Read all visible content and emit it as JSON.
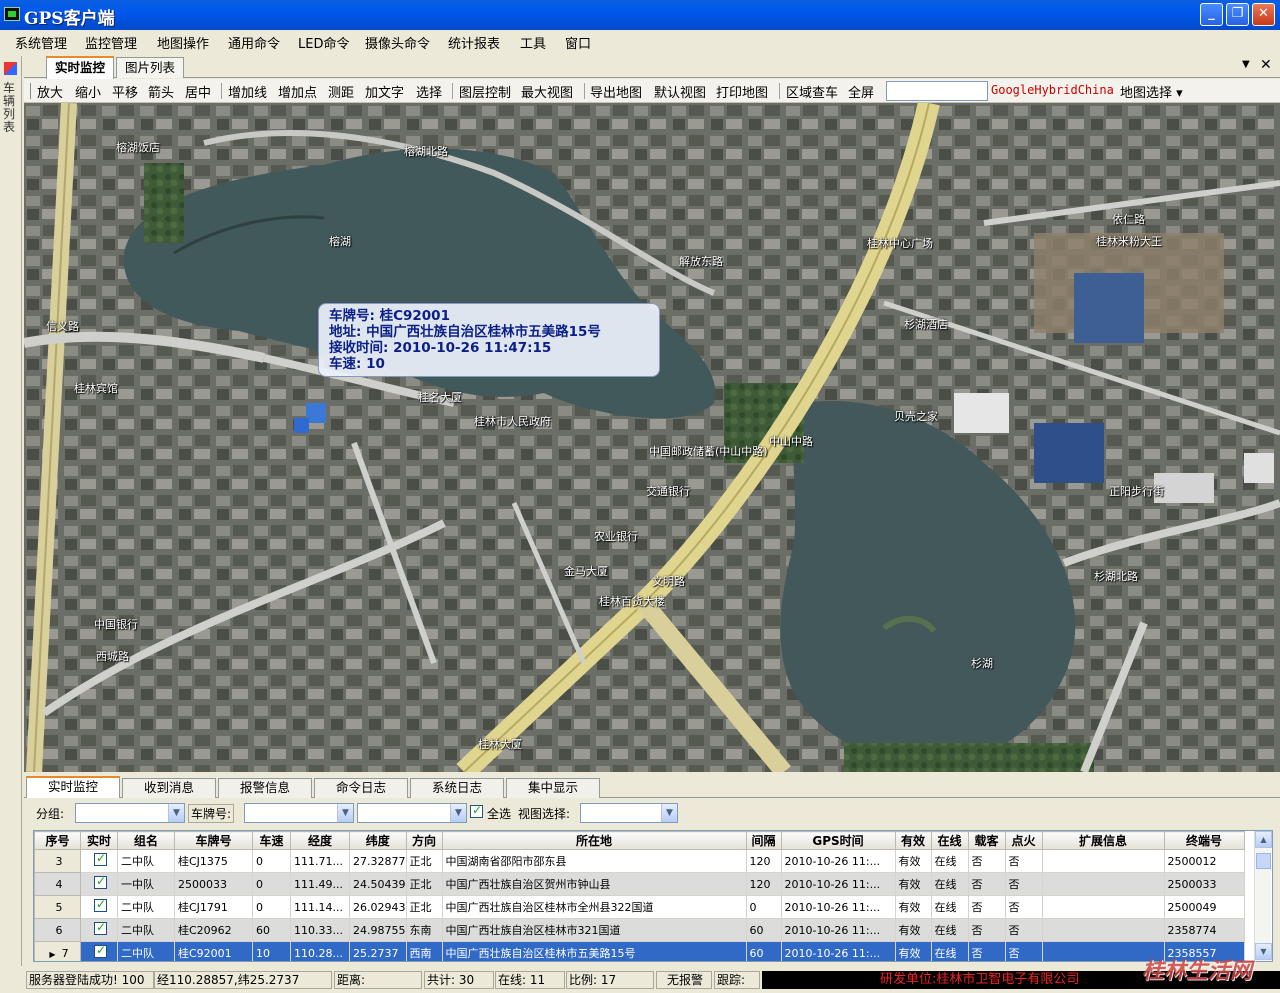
{
  "window": {
    "title": "GPS客户端",
    "buttons": [
      "_",
      "❐",
      "✕"
    ]
  },
  "menu": [
    "系统管理",
    "监控管理",
    "地图操作",
    "通用命令",
    "LED命令",
    "摄像头命令",
    "统计报表",
    "工具",
    "窗口"
  ],
  "left_panel_label": "车辆列表",
  "top_tabs": [
    "实时监控",
    "图片列表"
  ],
  "toolbar": {
    "group1": [
      "放大",
      "缩小",
      "平移",
      "箭头",
      "居中"
    ],
    "group2": [
      "增加线",
      "增加点",
      "测距",
      "加文字",
      "选择"
    ],
    "group3": [
      "图层控制",
      "最大视图"
    ],
    "group4": [
      "导出地图",
      "默认视图",
      "打印地图"
    ],
    "group5": [
      "区域查车",
      "全屏"
    ],
    "map_type": "GoogleHybridChina",
    "map_select": "地图选择"
  },
  "map": {
    "popup": {
      "plate": "车牌号: 桂C92001",
      "address": "地址: 中国广西壮族自治区桂林市五美路15号",
      "time": "接收时间: 2010-10-26 11:47:15",
      "speed": "车速: 10"
    },
    "labels": [
      "榕湖",
      "杉湖",
      "榕湖北路",
      "信义路",
      "中山中路",
      "文明路",
      "杉湖北路",
      "解放东路",
      "桂林市人民政府",
      "中国邮政储蓄(中山中路)",
      "交通银行",
      "农业银行",
      "金马大厦",
      "桂林百货大楼",
      "正阳步行街",
      "依仁路",
      "桂林中心广场",
      "桂林米粉大王",
      "中国银行",
      "榕湖饭店",
      "贝壳之家",
      "桂林宾馆",
      "西城路",
      "桂林大厦",
      "杉湖酒店",
      "桂名大厦"
    ]
  },
  "bottom_tabs": [
    "实时监控",
    "收到消息",
    "报警信息",
    "命令日志",
    "系统日志",
    "集中显示"
  ],
  "filter": {
    "group_label": "分组:",
    "plate_label": "车牌号:",
    "select_all": "全选",
    "view_label": "视图选择:"
  },
  "grid": {
    "columns": [
      "序号",
      "实时",
      "组名",
      "车牌号",
      "车速",
      "经度",
      "纬度",
      "方向",
      "所在地",
      "间隔",
      "GPS时间",
      "有效",
      "在线",
      "载客",
      "点火",
      "扩展信息",
      "终端号"
    ],
    "rows": [
      [
        "3",
        "",
        "二中队",
        "桂CJ1375",
        "0",
        "111.71...",
        "27.32877",
        "正北",
        "中国湖南省邵阳市邵东县",
        "120",
        "2010-10-26 11:...",
        "有效",
        "在线",
        "否",
        "否",
        "",
        "2500012"
      ],
      [
        "4",
        "",
        "一中队",
        "2500033",
        "0",
        "111.49...",
        "24.50439",
        "正北",
        "中国广西壮族自治区贺州市钟山县",
        "120",
        "2010-10-26 11:...",
        "有效",
        "在线",
        "否",
        "否",
        "",
        "2500033"
      ],
      [
        "5",
        "",
        "二中队",
        "桂CJ1791",
        "0",
        "111.14...",
        "26.02943",
        "正北",
        "中国广西壮族自治区桂林市全州县322国道",
        "0",
        "2010-10-26 11:...",
        "有效",
        "在线",
        "否",
        "否",
        "",
        "2500049"
      ],
      [
        "6",
        "",
        "二中队",
        "桂C20962",
        "60",
        "110.33...",
        "24.98755",
        "东南",
        "中国广西壮族自治区桂林市321国道",
        "60",
        "2010-10-26 11:...",
        "有效",
        "在线",
        "否",
        "否",
        "",
        "2358774"
      ],
      [
        "7",
        "",
        "二中队",
        "桂C92001",
        "10",
        "110.28...",
        "25.2737",
        "西南",
        "中国广西壮族自治区桂林市五美路15号",
        "60",
        "2010-10-26 11:...",
        "有效",
        "在线",
        "否",
        "否",
        "",
        "2358557"
      ]
    ],
    "selected_row_marker": "▶"
  },
  "status": {
    "login": "服务器登陆成功! 100",
    "coords": "经110.28857,纬25.2737",
    "distance": "距离:",
    "total": "共计: 30",
    "online": "在线: 11",
    "scale": "比例: 17",
    "alarm": "无报警",
    "track": "跟踪:",
    "org": "研发单位:桂林市卫智电子有限公司",
    "watermark": "桂林生活网"
  }
}
